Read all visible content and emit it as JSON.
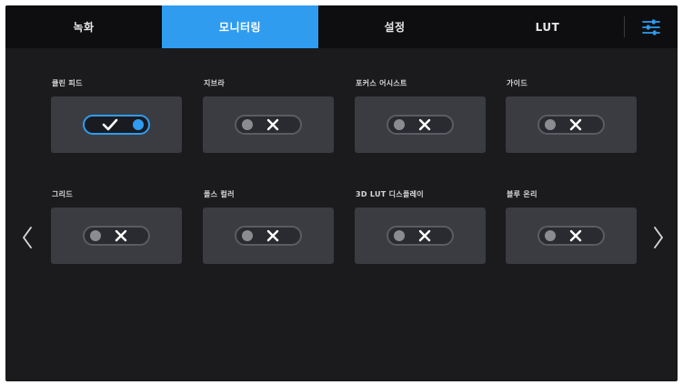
{
  "tabs": [
    {
      "label": "녹화",
      "active": false
    },
    {
      "label": "모니터링",
      "active": true
    },
    {
      "label": "설정",
      "active": false
    },
    {
      "label": "LUT",
      "active": false
    }
  ],
  "colors": {
    "accent": "#2f9cf0",
    "background": "#1b1b1e",
    "card": "#3a3c42",
    "tabbar": "#0e0e10"
  },
  "settings_icon": "sliders-icon",
  "toggles": [
    {
      "label": "클린 피드",
      "state": "on"
    },
    {
      "label": "지브라",
      "state": "off"
    },
    {
      "label": "포커스 어시스트",
      "state": "off"
    },
    {
      "label": "가이드",
      "state": "off"
    },
    {
      "label": "그리드",
      "state": "off"
    },
    {
      "label": "폴스 컬러",
      "state": "off"
    },
    {
      "label": "3D LUT 디스플레이",
      "state": "off"
    },
    {
      "label": "블루 온리",
      "state": "off"
    }
  ],
  "nav": {
    "prev_icon": "chevron-left-icon",
    "next_icon": "chevron-right-icon"
  }
}
